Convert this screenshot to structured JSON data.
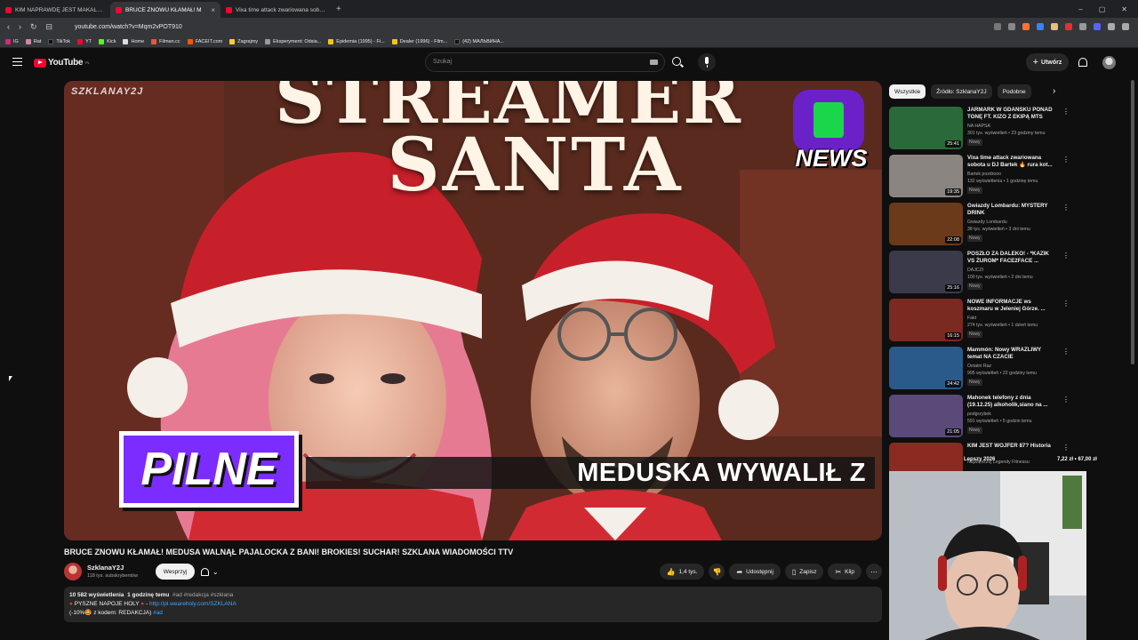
{
  "browser": {
    "tabs": [
      {
        "title": "KIM NAPRAWDĘ JEST MAKALJER? W",
        "active": false
      },
      {
        "title": "BRUCE ZNOWU KŁAMAŁ! M",
        "active": true
      },
      {
        "title": "Vixa time attack zwariowana sobota",
        "active": false
      }
    ],
    "url": "youtube.com/watch?v=Mqm2vPOT910",
    "bookmarks": [
      "IG",
      "Rat",
      "TikTok",
      "YT",
      "Kick",
      "Home",
      "Filman.cc",
      "FACEIT.com",
      "Zagrajmy",
      "Eksperyment: Odsia...",
      "Epidemia (1995) - Fi...",
      "Dealer (1996) - Film...",
      "(42) МАЛЬВИНА..."
    ]
  },
  "header": {
    "logo_text": "YouTube",
    "region": "PL",
    "search_placeholder": "Szukaj",
    "create_label": "Utwórz"
  },
  "thumbnail": {
    "channel_watermark": "SZKLANAY2J",
    "headline_1": "STREAMER",
    "headline_2": "SANTA",
    "badge": "NEWS",
    "urgent_label": "PILNE",
    "ticker_text": "MEDUSKA WYWALIŁ Z"
  },
  "video": {
    "title": "BRUCE ZNOWU KŁAMAŁ! MEDUSA WALNĄŁ PAJALOCKA Z BANI! BROKIES! SUCHAR! SZKLANA WIADOMOŚCI TTV",
    "channel": "SzklanaY2J",
    "subscribers": "118 tys. subskrybentów",
    "support_label": "Wesprzyj",
    "likes": "1,4 tys.",
    "share_label": "Udostępnij",
    "save_label": "Zapisz",
    "clip_label": "Klip"
  },
  "description": {
    "views": "10 582 wyświetlenia",
    "time": "1 godzinę temu",
    "tags": "#ad #redakcja #szklana",
    "line2_prefix": "PYSZNE NAPOJE HOLY",
    "line2_link": "http://pl.weareholy.com/SZKLANA",
    "line3_text": "(-10%🤩 z kodem: REDAKCJA)",
    "line3_tag": "#ad"
  },
  "sidebar": {
    "chips": [
      "Wszystkie",
      "Źródło: SzklanaY2J",
      "Podobne"
    ],
    "recommendations": [
      {
        "title": "JARMARK W GDAŃSKU PONAD TONĘ FT. KIZO Z EKIPĄ MTS",
        "channel": "NA HAPSA",
        "meta": "301 tys. wyświetleń • 23 godziny temu",
        "badge": "Nowy",
        "duration": "25:41",
        "color": "#2a6a3a"
      },
      {
        "title": "Vixa time attack zwariowana sobota u DJ Bartek 🔥 rura kot...",
        "channel": "Bartek pozdrooo",
        "meta": "132 wyświetlenia • 1 godzinę temu",
        "badge": "Nowy",
        "duration": "19:35",
        "color": "#8a8580"
      },
      {
        "title": "Gwiazdy Lombardu: MYSTERY DRINK",
        "channel": "Gwiazdy Lombardu",
        "meta": "38 tys. wyświetleń • 3 dni temu",
        "badge": "Nowy",
        "duration": "22:08",
        "color": "#6a3a1a"
      },
      {
        "title": "POSZŁO ZA DALEKO! - *KAZIK VS ŻUROM* FACE2FACE ...",
        "channel": "DAJCZI",
        "meta": "100 tys. wyświetleń • 2 dni temu",
        "badge": "Nowy",
        "duration": "25:16",
        "color": "#3a3a4a"
      },
      {
        "title": "NOWE INFORMACJE ws koszmaru w Jeleniej Górze. ...",
        "channel": "Fakt",
        "meta": "274 tys. wyświetleń • 1 dzień temu",
        "badge": "Nowy",
        "duration": "16:15",
        "color": "#7a2a20"
      },
      {
        "title": "Mammón: Nowy WRAŻLIWY temat NA CZACIE",
        "channel": "Ostatni Raz",
        "meta": "995 wyświetleń • 22 godziny temu",
        "badge": "Nowy",
        "duration": "24:42",
        "color": "#2a5a8a"
      },
      {
        "title": "Mahonek telefony z dnia (19.12.25) alkoholik,siano na ...",
        "channel": "podgrzybek",
        "meta": "591 wyświetleń • 5 godzin temu",
        "badge": "Nowy",
        "duration": "21:05",
        "color": "#5a4a7a"
      },
      {
        "title": "KIM JEST WOJFER 87? Historia",
        "channel": "Największej Legendy Fitnessu",
        "meta": "",
        "badge": "",
        "duration": "",
        "color": "#8a2a20"
      }
    ]
  },
  "stream_overlay": {
    "label": "Lepszy 2026",
    "price": "7,22 zł • 67,00 zł"
  }
}
